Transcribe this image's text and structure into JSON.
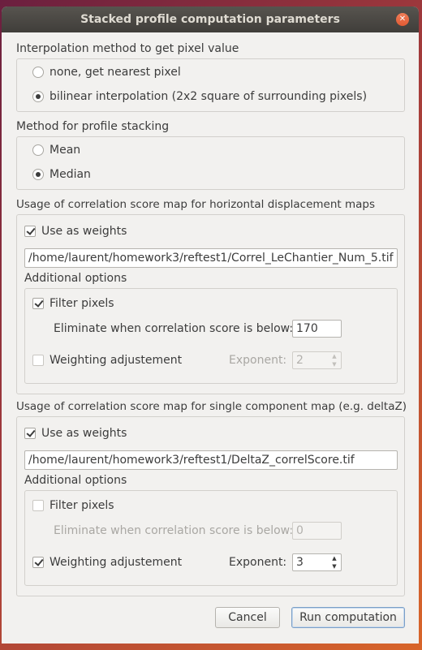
{
  "window": {
    "title": "Stacked profile computation parameters"
  },
  "interp": {
    "title": "Interpolation method to get pixel value",
    "options": [
      "none, get nearest pixel",
      "bilinear interpolation (2x2 square of surrounding pixels)"
    ],
    "selected": 1
  },
  "stacking": {
    "title": "Method for profile stacking",
    "options": [
      "Mean",
      "Median"
    ],
    "selected": 1
  },
  "horiz": {
    "title": "Usage of correlation score map for horizontal displacement maps",
    "use_weights_label": "Use as weights",
    "use_weights": true,
    "path": "/home/laurent/homework3/reftest1/Correl_LeChantier_Num_5.tif",
    "additional_title": "Additional options",
    "filter_label": "Filter pixels",
    "filter": true,
    "eliminate_label": "Eliminate when correlation score is below:",
    "eliminate_value": "170",
    "weighting_label": "Weighting adjustement",
    "weighting": false,
    "exponent_label": "Exponent:",
    "exponent_value": "2"
  },
  "single": {
    "title": "Usage of correlation score map for single component map (e.g. deltaZ)",
    "use_weights_label": "Use as weights",
    "use_weights": true,
    "path": "/home/laurent/homework3/reftest1/DeltaZ_correlScore.tif",
    "additional_title": "Additional options",
    "filter_label": "Filter pixels",
    "filter": false,
    "eliminate_label": "Eliminate when correlation score is below:",
    "eliminate_value": "0",
    "weighting_label": "Weighting adjustement",
    "weighting": true,
    "exponent_label": "Exponent:",
    "exponent_value": "3"
  },
  "buttons": {
    "cancel": "Cancel",
    "run": "Run computation"
  }
}
